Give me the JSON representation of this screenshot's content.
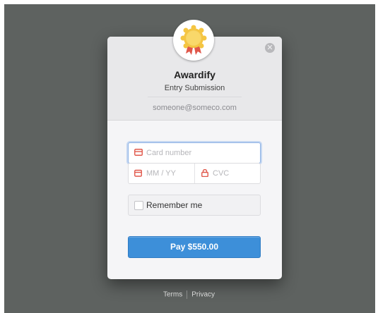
{
  "modal": {
    "brand": "Awardify",
    "subtitle": "Entry Submission",
    "email": "someone@someco.com",
    "close_icon": "close-icon",
    "badge_icon": "award-ribbon-icon"
  },
  "form": {
    "card_number_placeholder": "Card number",
    "expiry_placeholder": "MM / YY",
    "cvc_placeholder": "CVC",
    "remember_label": "Remember me",
    "remember_checked": false,
    "pay_label": "Pay $550.00"
  },
  "footer": {
    "terms": "Terms",
    "privacy": "Privacy"
  },
  "colors": {
    "backdrop": "#5e6260",
    "accent": "#3d8fd9",
    "icon_red": "#e0574a",
    "badge_gold": "#f4c542"
  }
}
